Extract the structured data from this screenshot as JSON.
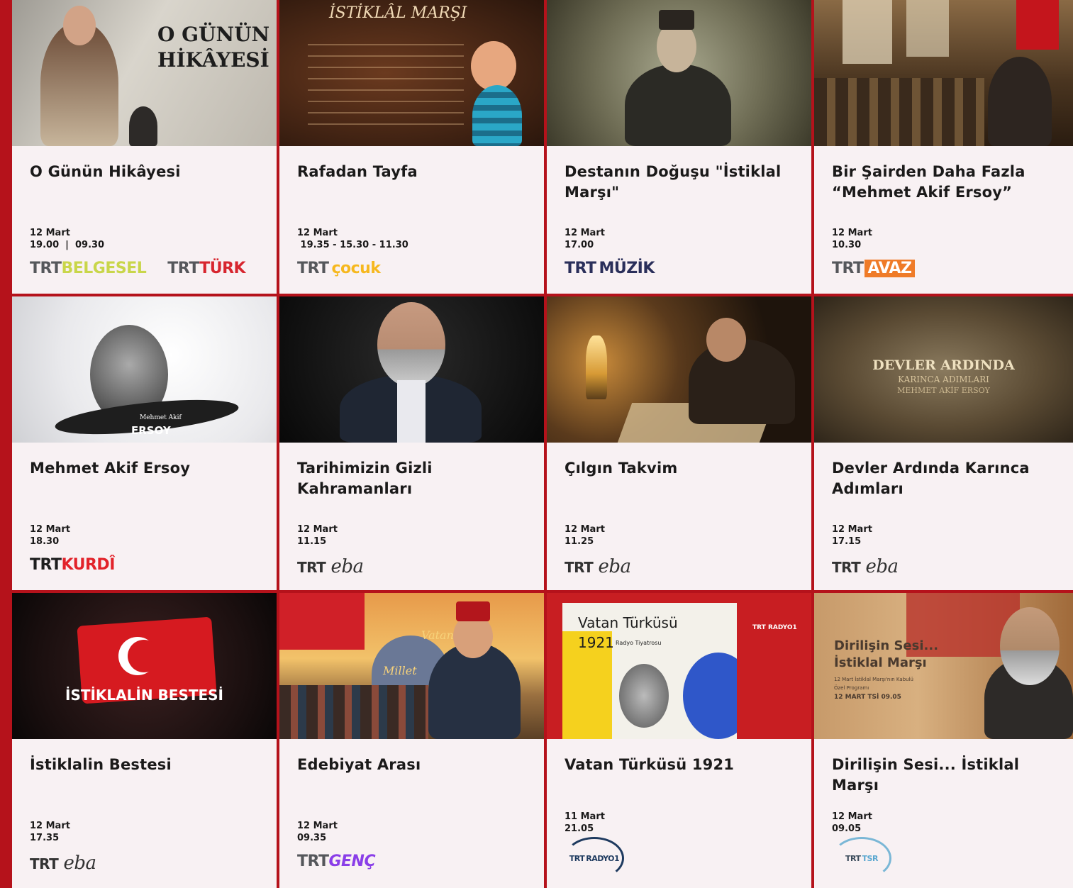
{
  "cards": [
    {
      "title": "O Günün Hikâyesi",
      "date": "12 Mart",
      "time": "19.00  |  09.30",
      "thumb_text": [
        "O GÜNÜN",
        "HİKÂYESİ"
      ],
      "logos": [
        {
          "prefix": "TRT",
          "suffix": "BELGESEL",
          "color": "#c9d64a"
        },
        {
          "prefix": "TRT",
          "suffix": "TÜRK",
          "color": "#d7262f"
        }
      ]
    },
    {
      "title": "Rafadan Tayfa",
      "date": "12 Mart",
      "time": " 19.35 - 15.30 - 11.30",
      "thumb_text": [
        "İSTİKLÂL MARŞI"
      ],
      "logos": [
        {
          "prefix": "TRT",
          "suffix": "çocuk",
          "color": "#f6b81e"
        }
      ]
    },
    {
      "title": "Destanın Doğuşu \"İstiklal Marşı\"",
      "date": "12 Mart",
      "time": "17.00",
      "logos": [
        {
          "prefix": "TRT",
          "suffix": "MÜZİK",
          "color": "#2a2f5a"
        }
      ]
    },
    {
      "title": "Bir Şairden Daha Fazla “Mehmet Akif Ersoy”",
      "date": "12 Mart",
      "time": "10.30",
      "logos": [
        {
          "prefix": "TRT",
          "suffix": "AVAZ",
          "color": "#ef7b28",
          "style": "avaz"
        }
      ]
    },
    {
      "title": "Mehmet Akif Ersoy",
      "date": "12 Mart",
      "time": "18.30",
      "thumb_text": [
        "Mehmet Akif",
        "ERSOY"
      ],
      "logos": [
        {
          "prefix": "TRT",
          "suffix": "KURDÎ",
          "color": "#e2232a"
        }
      ]
    },
    {
      "title": "Tarihimizin Gizli Kahramanları",
      "date": "12 Mart",
      "time": "11.15",
      "logos": [
        {
          "prefix": "TRT",
          "suffix": "eba",
          "color": "#333333",
          "style": "eba"
        }
      ]
    },
    {
      "title": "Çılgın Takvim",
      "date": "12 Mart",
      "time": "11.25",
      "logos": [
        {
          "prefix": "TRT",
          "suffix": "eba",
          "color": "#333333",
          "style": "eba"
        }
      ]
    },
    {
      "title": "Devler Ardında Karınca Adımları",
      "date": "12 Mart",
      "time": "17.15",
      "thumb_text": [
        "DEVLER ARDINDA",
        "KARINCA ADIMLARI",
        "MEHMET AKİF ERSOY"
      ],
      "logos": [
        {
          "prefix": "TRT",
          "suffix": "eba",
          "color": "#333333",
          "style": "eba"
        }
      ]
    },
    {
      "title": "İstiklalin Bestesi",
      "date": "12 Mart",
      "time": "17.35",
      "thumb_text": [
        "İSTİKLALİN BESTESİ"
      ],
      "logos": [
        {
          "prefix": "TRT",
          "suffix": "eba",
          "color": "#333333",
          "style": "eba"
        }
      ]
    },
    {
      "title": "Edebiyat Arası",
      "date": "12 Mart",
      "time": "09.35",
      "thumb_text": [
        "Vatan",
        "Millet"
      ],
      "logos": [
        {
          "prefix": "TRT",
          "suffix": "GENÇ",
          "color": "#8a3ee8"
        }
      ]
    },
    {
      "title": "Vatan Türküsü 1921",
      "date": "11 Mart",
      "time": "21.05",
      "thumb_text": [
        "Vatan Türküsü",
        "1921",
        "Radyo Tiyatrosu",
        "TRT RADYO1"
      ],
      "logos": [
        {
          "prefix": "TRT",
          "suffix": "RADYO1",
          "color": "#1e3a5f",
          "style": "circle dark"
        }
      ]
    },
    {
      "title": "Dirilişin Sesi... İstiklal Marşı",
      "date": "12 Mart",
      "time": "09.05",
      "thumb_text": [
        "Dirilişin Sesi...",
        "İstiklal Marşı",
        "12 Mart İstiklal Marşı'nın Kabulü",
        "Özel Programı",
        "12 MART TSİ 09.05"
      ],
      "logos": [
        {
          "prefix": "TRT",
          "suffix": "TSR",
          "color": "#5aa7d0",
          "style": "circle"
        }
      ]
    }
  ]
}
